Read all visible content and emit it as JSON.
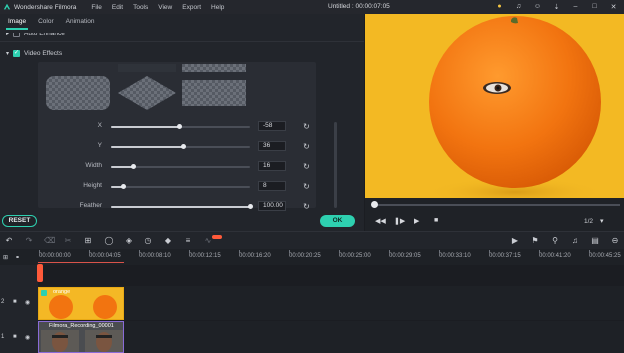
{
  "app": {
    "name": "Wondershare Filmora",
    "window_title": "Untitled : 00:00:07:05",
    "menu": [
      "File",
      "Edit",
      "Tools",
      "View",
      "Export",
      "Help"
    ]
  },
  "panel": {
    "tabs": [
      "Image",
      "Color",
      "Animation"
    ],
    "active_tab": "Image",
    "auto_enhance_label": "Auto Enhance",
    "video_effects_label": "Video Effects",
    "params": [
      {
        "label": "X",
        "value": "-58",
        "fraction": 0.49
      },
      {
        "label": "Y",
        "value": "36",
        "fraction": 0.52
      },
      {
        "label": "Width",
        "value": "16",
        "fraction": 0.16
      },
      {
        "label": "Height",
        "value": "8",
        "fraction": 0.09
      },
      {
        "label": "Feather",
        "value": "100.00",
        "fraction": 1.0
      }
    ],
    "reset_label": "RESET",
    "ok_label": "OK"
  },
  "preview": {
    "ratio": "1/2",
    "progress": 0.0
  },
  "timeline": {
    "timecodes": [
      "00:00:00:00",
      "00:00:04:05",
      "00:00:08:10",
      "00:00:12:15",
      "00:00:16:20",
      "00:00:20:25",
      "00:00:25:00",
      "00:00:29:05",
      "00:00:33:10",
      "00:00:37:15",
      "00:00:41:20",
      "00:00:45:25"
    ],
    "track2_number": "2",
    "track1_number": "1",
    "clip2_name": "orange",
    "clip1_name": "Filmora_Recording_00001"
  },
  "colors": {
    "accent": "#2ed0b0",
    "preview_bg": "#f3b923",
    "orange": "#f07a12",
    "playhead": "#ff5a3a"
  }
}
